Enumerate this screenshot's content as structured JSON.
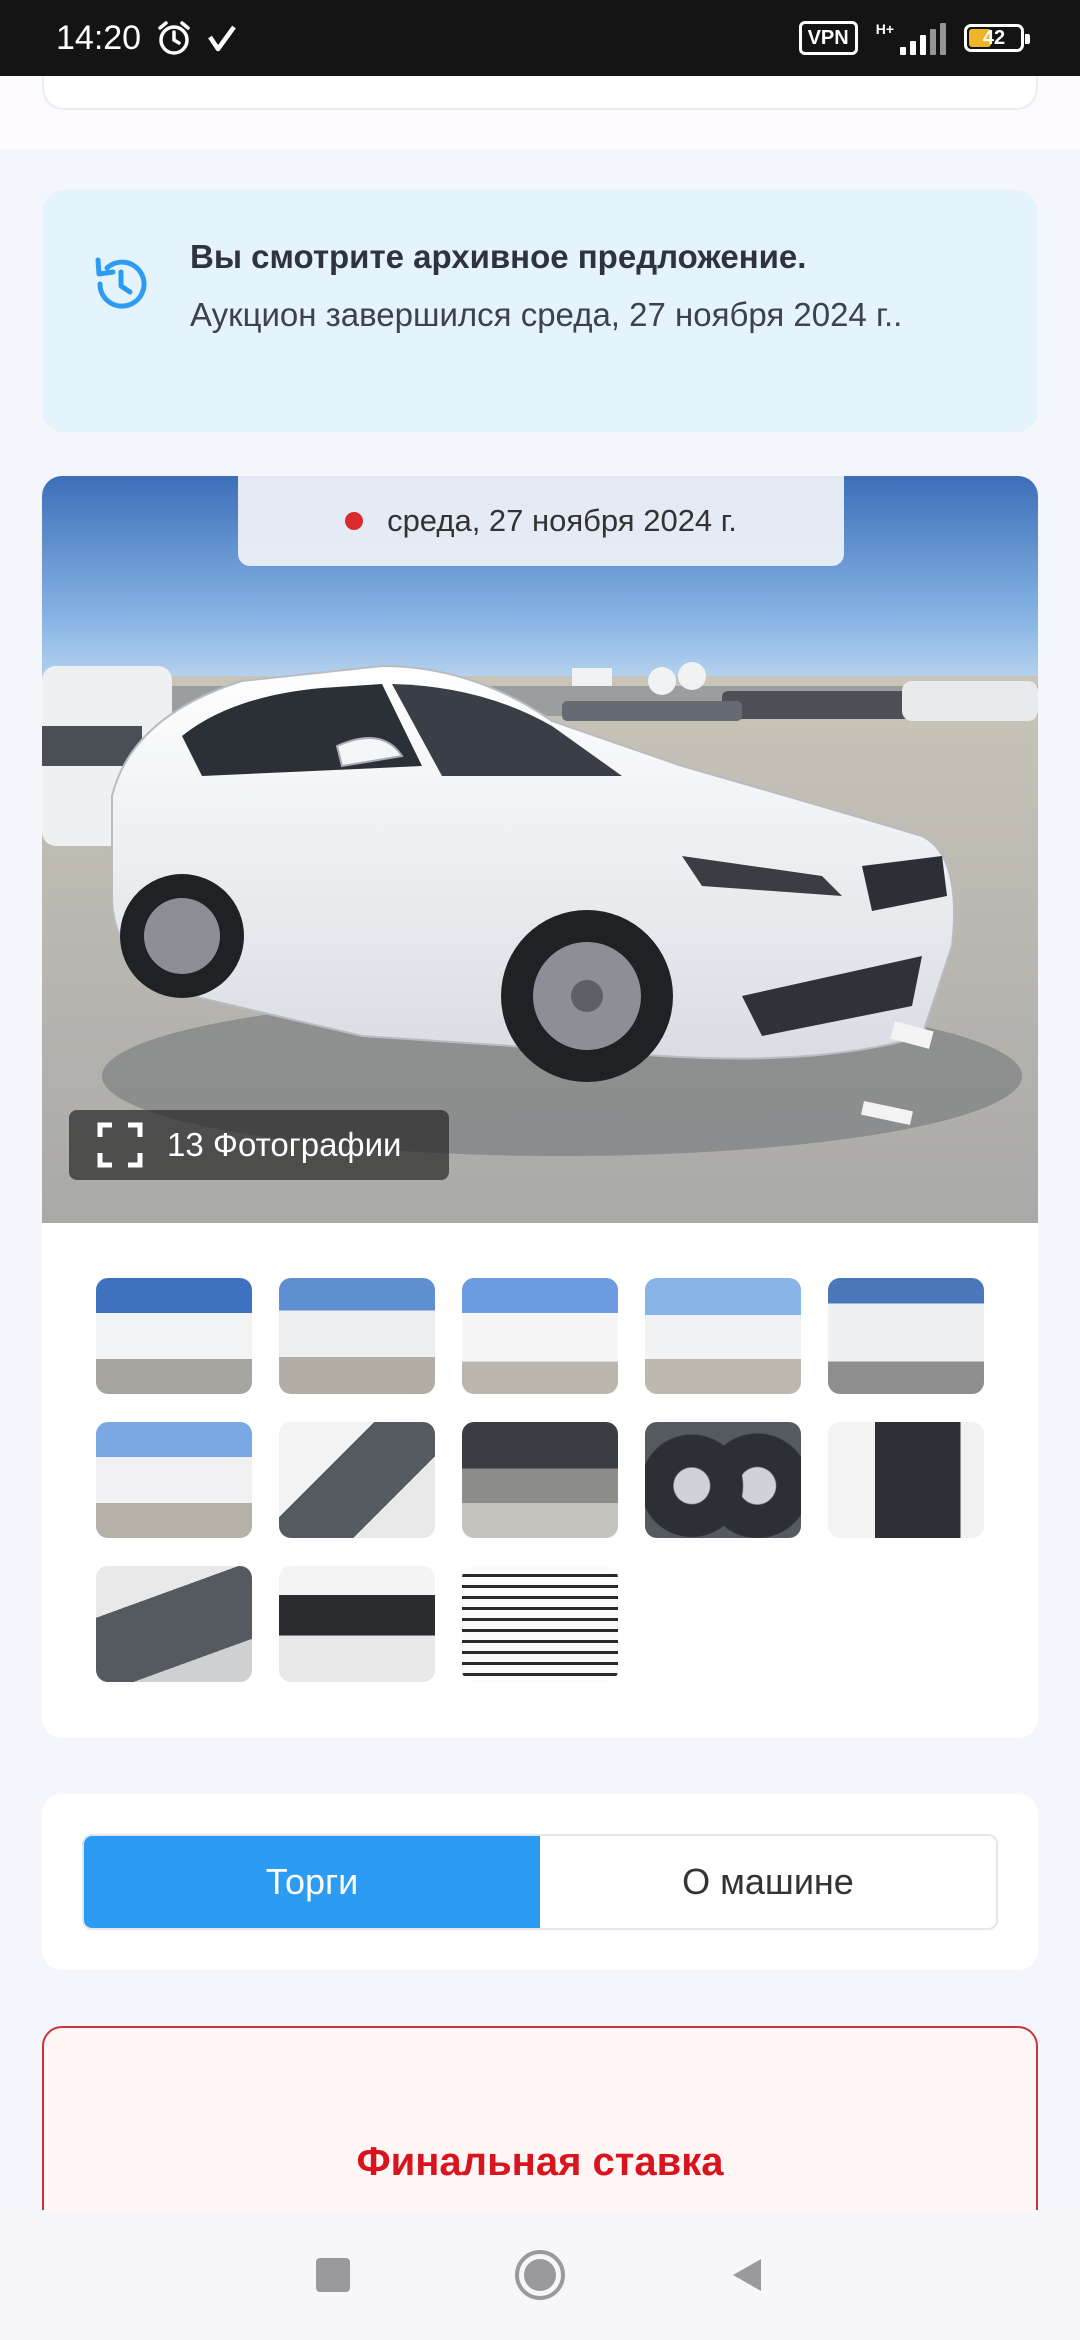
{
  "status_bar": {
    "time": "14:20",
    "vpn": "VPN",
    "network": "H+",
    "battery": "42",
    "icons": [
      "alarm-icon",
      "check-icon",
      "signal-icon",
      "battery-icon"
    ]
  },
  "notice": {
    "title": "Вы смотрите архивное предложение.",
    "text": "Аукцион завершился среда, 27 ноября 2024 г..",
    "icon": "history-icon",
    "color": "#e5f3fc"
  },
  "gallery": {
    "date": "среда, 27 ноября 2024 г.",
    "photos_label": "13 Фотографии",
    "thumbnail_count": 13
  },
  "tabs": [
    {
      "label": "Торги",
      "active": true
    },
    {
      "label": "О машине",
      "active": false
    }
  ],
  "final_bid": {
    "label": "Финальная ставка",
    "color": "#d8141e"
  },
  "navbar": {
    "icons": [
      "recent-apps-icon",
      "home-icon",
      "back-icon"
    ]
  }
}
